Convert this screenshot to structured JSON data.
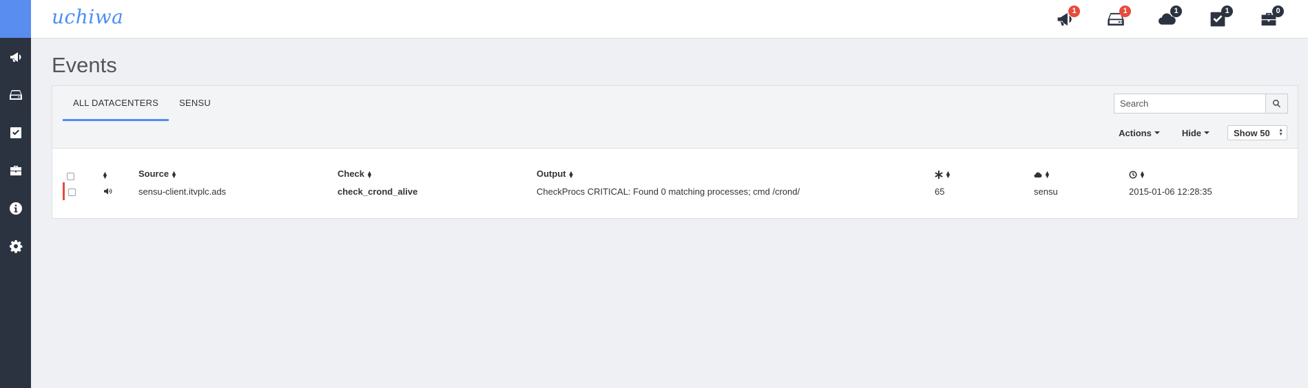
{
  "app": {
    "logo": "uchiwa"
  },
  "sidebar": {
    "items": [
      {
        "icon": "megaphone-icon",
        "name": "events"
      },
      {
        "icon": "server-icon",
        "name": "clients"
      },
      {
        "icon": "checkbox-icon",
        "name": "checks"
      },
      {
        "icon": "briefcase-icon",
        "name": "stashes"
      },
      {
        "icon": "info-icon",
        "name": "info"
      },
      {
        "icon": "gear-icon",
        "name": "settings"
      }
    ]
  },
  "topbar": {
    "icons": [
      {
        "icon": "megaphone-icon",
        "badge": "1",
        "badge_color": "#e74c3c"
      },
      {
        "icon": "server-icon",
        "badge": "1",
        "badge_color": "#e74c3c"
      },
      {
        "icon": "cloud-icon",
        "badge": "1",
        "badge_color": "#2c3340"
      },
      {
        "icon": "checkbox-icon",
        "badge": "1",
        "badge_color": "#2c3340"
      },
      {
        "icon": "briefcase-icon",
        "badge": "0",
        "badge_color": "#2c3340"
      }
    ]
  },
  "page": {
    "title": "Events"
  },
  "tabs": [
    {
      "label": "ALL DATACENTERS",
      "active": true
    },
    {
      "label": "SENSU",
      "active": false
    }
  ],
  "search": {
    "placeholder": "Search"
  },
  "controls": {
    "actions": "Actions",
    "hide": "Hide",
    "show": "Show 50"
  },
  "table": {
    "headers": {
      "source": "Source",
      "check": "Check",
      "output": "Output"
    },
    "rows": [
      {
        "status_color": "#e74c3c",
        "source": "sensu-client.itvplc.ads",
        "check": "check_crond_alive",
        "output": "CheckProcs CRITICAL: Found 0 matching processes; cmd /crond/",
        "occurrences": "65",
        "datacenter": "sensu",
        "timestamp": "2015-01-06 12:28:35"
      }
    ]
  },
  "colors": {
    "accent": "#4c8ef5",
    "sidebar": "#2c3340",
    "critical": "#e74c3c"
  }
}
